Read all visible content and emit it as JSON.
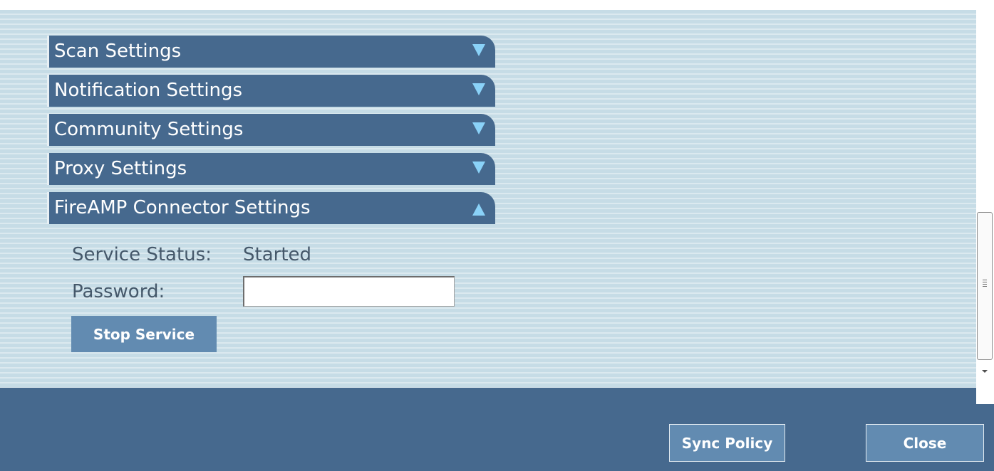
{
  "sections": [
    {
      "label": "Scan Settings",
      "expanded": false
    },
    {
      "label": "Notification Settings",
      "expanded": false
    },
    {
      "label": "Community Settings",
      "expanded": false
    },
    {
      "label": "Proxy Settings",
      "expanded": false
    },
    {
      "label": "FireAMP Connector Settings",
      "expanded": true
    }
  ],
  "connector": {
    "service_status_label": "Service Status:",
    "service_status_value": "Started",
    "password_label": "Password:",
    "password_value": "",
    "stop_button": "Stop Service"
  },
  "footer": {
    "sync_button": "Sync Policy",
    "close_button": "Close"
  },
  "colors": {
    "header_blue": "#46698e",
    "button_blue": "#628bb1",
    "panel_bg": "#c6dce6",
    "arrow": "#8ad2f8"
  }
}
